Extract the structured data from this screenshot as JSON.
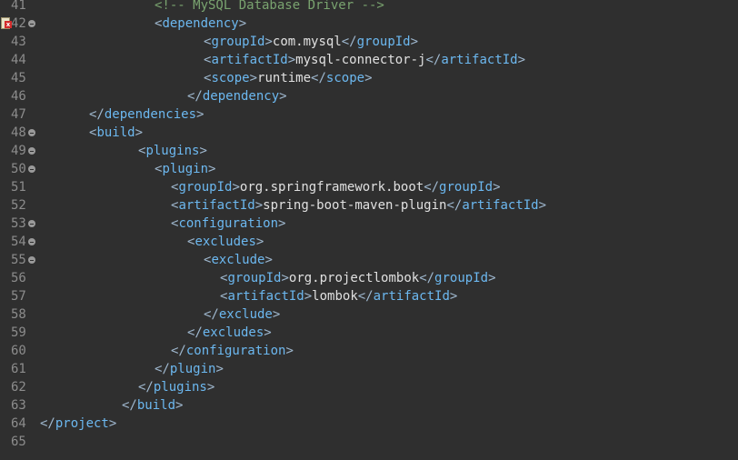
{
  "editor": {
    "lines": [
      {
        "num": "41",
        "indent": 14,
        "comment": "<!-- MySQL Database Driver -->"
      },
      {
        "num": "42",
        "indent": 14,
        "fold": true,
        "error": true,
        "open_tag": "dependency"
      },
      {
        "num": "43",
        "indent": 20,
        "open_tag": "groupId",
        "text": "com.mysql",
        "close_tag": "groupId"
      },
      {
        "num": "44",
        "indent": 20,
        "open_tag": "artifactId",
        "text": "mysql-connector-j",
        "close_tag": "artifactId"
      },
      {
        "num": "45",
        "indent": 20,
        "open_tag": "scope",
        "text": "runtime",
        "close_tag": "scope"
      },
      {
        "num": "46",
        "indent": 18,
        "close_tag": "dependency"
      },
      {
        "num": "47",
        "indent": 6,
        "close_tag": "dependencies"
      },
      {
        "num": "48",
        "indent": 6,
        "fold": true,
        "open_tag": "build"
      },
      {
        "num": "49",
        "indent": 12,
        "fold": true,
        "open_tag": "plugins"
      },
      {
        "num": "50",
        "indent": 14,
        "fold": true,
        "open_tag": "plugin"
      },
      {
        "num": "51",
        "indent": 16,
        "open_tag": "groupId",
        "text": "org.springframework.boot",
        "close_tag": "groupId"
      },
      {
        "num": "52",
        "indent": 16,
        "open_tag": "artifactId",
        "text": "spring-boot-maven-plugin",
        "close_tag": "artifactId"
      },
      {
        "num": "53",
        "indent": 16,
        "fold": true,
        "open_tag": "configuration"
      },
      {
        "num": "54",
        "indent": 18,
        "fold": true,
        "open_tag": "excludes"
      },
      {
        "num": "55",
        "indent": 20,
        "fold": true,
        "open_tag": "exclude"
      },
      {
        "num": "56",
        "indent": 22,
        "open_tag": "groupId",
        "text": "org.projectlombok",
        "close_tag": "groupId"
      },
      {
        "num": "57",
        "indent": 22,
        "open_tag": "artifactId",
        "text": "lombok",
        "close_tag": "artifactId"
      },
      {
        "num": "58",
        "indent": 20,
        "close_tag": "exclude"
      },
      {
        "num": "59",
        "indent": 18,
        "close_tag": "excludes"
      },
      {
        "num": "60",
        "indent": 16,
        "close_tag": "configuration"
      },
      {
        "num": "61",
        "indent": 14,
        "close_tag": "plugin"
      },
      {
        "num": "62",
        "indent": 12,
        "close_tag": "plugins"
      },
      {
        "num": "63",
        "indent": 10,
        "close_tag": "build"
      },
      {
        "num": "64",
        "indent": 0,
        "close_tag": "project"
      },
      {
        "num": "65",
        "indent": 0
      }
    ]
  },
  "colors": {
    "background": "#2f2f2f",
    "tag": "#6cb8f0",
    "angle_bracket": "#9fb8cf",
    "text": "#e0e0e0",
    "comment": "#79a36f",
    "line_number": "#8c8c8c"
  }
}
